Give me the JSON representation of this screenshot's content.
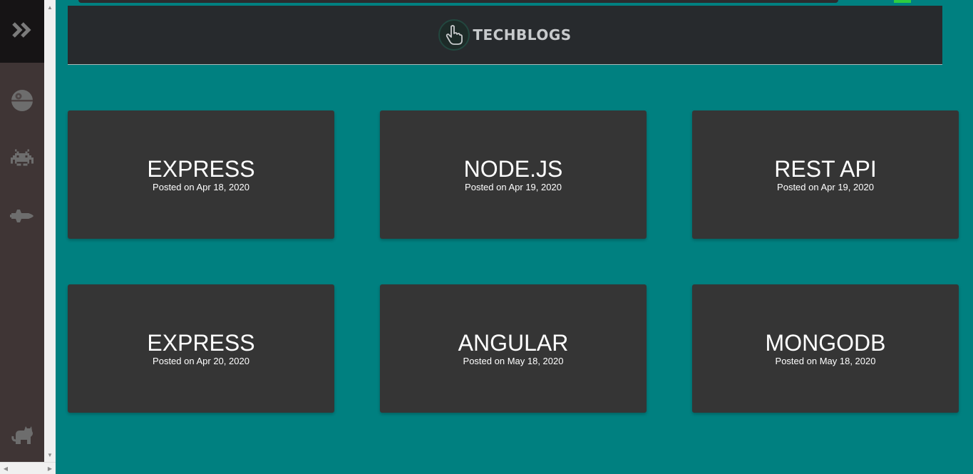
{
  "colors": {
    "page_background": "#008080",
    "card_background": "#353535",
    "header_background": "#272a2d",
    "sidebar_background": "#3f3535",
    "sidebar_toggle_background": "#161415",
    "sidebar_icon": "#6d6d6d"
  },
  "sidebar": {
    "toggle_icon": "double-chevron-right-icon",
    "items": [
      {
        "icon": "death-star-icon"
      },
      {
        "icon": "space-invader-icon"
      },
      {
        "icon": "space-shuttle-icon"
      }
    ],
    "footer_icon": "cat-icon"
  },
  "header": {
    "logo_icon": "pointing-hand-icon",
    "logo_text": "TECHBLOGS"
  },
  "posts": [
    {
      "title": "EXPRESS",
      "date": "Posted on Apr 18, 2020"
    },
    {
      "title": "NODE.JS",
      "date": "Posted on Apr 19, 2020"
    },
    {
      "title": "REST API",
      "date": "Posted on Apr 19, 2020"
    },
    {
      "title": "EXPRESS",
      "date": "Posted on Apr 20, 2020"
    },
    {
      "title": "ANGULAR",
      "date": "Posted on May 18, 2020"
    },
    {
      "title": "MONGODB",
      "date": "Posted on May 18, 2020"
    }
  ]
}
